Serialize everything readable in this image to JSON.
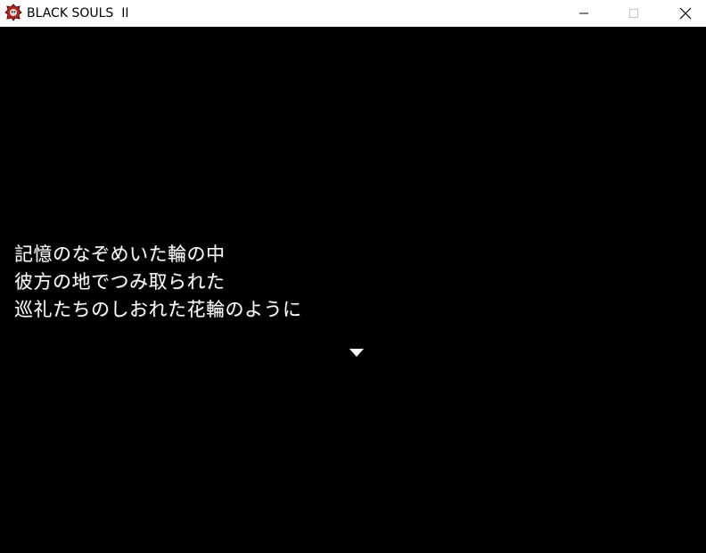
{
  "window": {
    "title": "BLACK SOULS  II",
    "icon": "game-icon",
    "controls": {
      "minimize_icon": "minimize-icon",
      "maximize_icon": "maximize-icon",
      "close_icon": "close-icon"
    }
  },
  "dialogue": {
    "lines": [
      "記憶のなぞめいた輪の中",
      "彼方の地でつみ取られた",
      "巡礼たちのしおれた花輪のように"
    ],
    "continue_icon": "down-triangle-icon"
  },
  "colors": {
    "background": "#000000",
    "text": "#ffffff",
    "titlebar": "#ffffff"
  }
}
